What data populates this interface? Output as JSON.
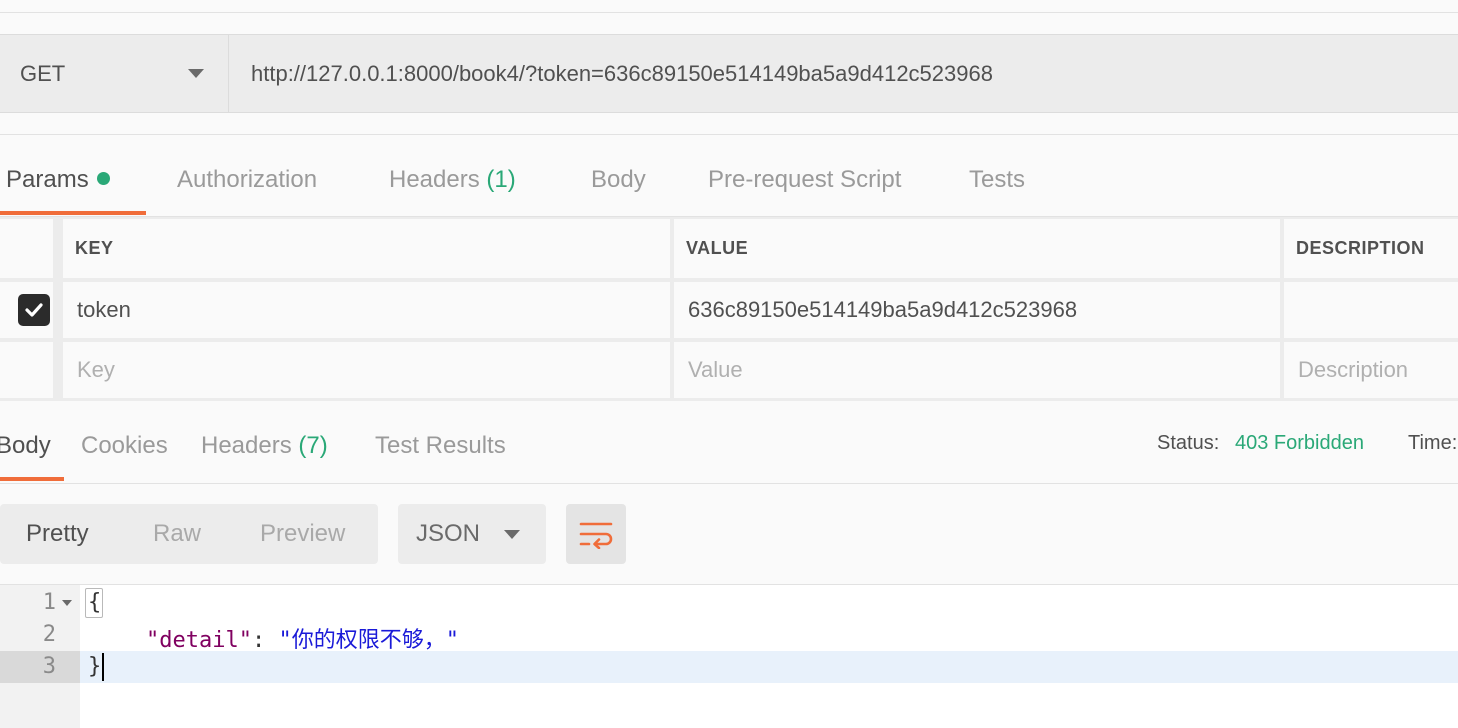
{
  "request": {
    "method": "GET",
    "url": "http://127.0.0.1:8000/book4/?token=636c89150e514149ba5a9d412c523968"
  },
  "request_tabs": {
    "params": "Params",
    "authorization": "Authorization",
    "headers": "Headers",
    "headers_count": "(1)",
    "body": "Body",
    "prerequest": "Pre-request Script",
    "tests": "Tests"
  },
  "params_table": {
    "headers": {
      "key": "KEY",
      "value": "VALUE",
      "description": "DESCRIPTION"
    },
    "rows": [
      {
        "checked": true,
        "key": "token",
        "value": "636c89150e514149ba5a9d412c523968",
        "description": ""
      }
    ],
    "placeholders": {
      "key": "Key",
      "value": "Value",
      "description": "Description"
    }
  },
  "response_tabs": {
    "body": "Body",
    "cookies": "Cookies",
    "headers": "Headers",
    "headers_count": "(7)",
    "test_results": "Test Results"
  },
  "status": {
    "label": "Status:",
    "value": "403 Forbidden",
    "time_label": "Time:"
  },
  "view_modes": {
    "pretty": "Pretty",
    "raw": "Raw",
    "preview": "Preview",
    "format": "JSON"
  },
  "editor": {
    "line_numbers": [
      "1",
      "2",
      "3"
    ],
    "open_brace": "{",
    "key": "\"detail\"",
    "colon": ": ",
    "value": "\"你的权限不够，\"",
    "close_brace": "}"
  },
  "colors": {
    "accent": "#f06d3a",
    "success": "#2aa877"
  },
  "icons": {
    "method_dropdown": "chevron-down-icon",
    "checkbox": "checkmark-icon",
    "format_dropdown": "chevron-down-icon",
    "wrap": "wrap-lines-icon",
    "fold": "fold-caret-icon"
  }
}
